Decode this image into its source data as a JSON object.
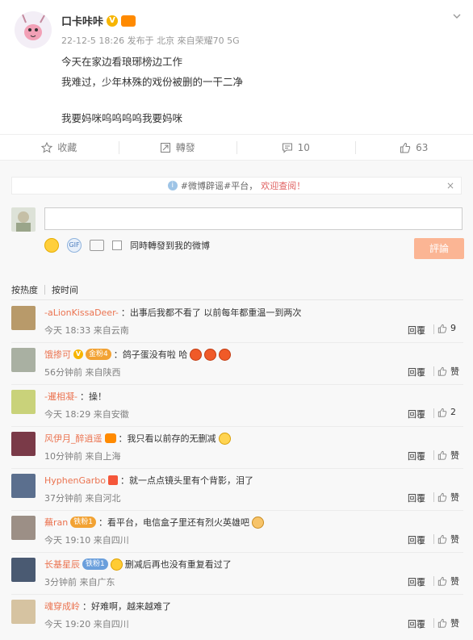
{
  "post": {
    "author": "口卡咔咔",
    "meta": "22-12-5 18:26 发布于 北京 來自荣耀70 5G",
    "lines": [
      "今天在家边看琅琊榜边工作",
      "我难过，少年林殊的戏份被删的一干二净",
      "我要妈咪呜呜呜呜我要妈咪"
    ]
  },
  "actions": {
    "favorite": "收藏",
    "repost": "轉發",
    "comment": "10",
    "like": "63"
  },
  "notice": {
    "text": "#微博辟谣#平台，",
    "warn": "欢迎查阅！",
    "close": "×"
  },
  "composer": {
    "sync_label": "同時轉發到我的微博",
    "submit_label": "評論",
    "gif_label": "GIF"
  },
  "sort": {
    "hot": "按热度",
    "time": "按时间"
  },
  "comments": [
    {
      "user": "-aLionKissaDeer-",
      "text": "：出事后我都不看了 以前每年都重温一到两次",
      "meta": "今天 18:33 来自云南",
      "reply": "回覆",
      "likes": "9"
    },
    {
      "user": "饿掺可",
      "badge": "金粉4",
      "text": "：鸽子蛋没有啦 哈",
      "meta": "56分钟前 来自陕西",
      "reply": "回覆",
      "likes": "赞"
    },
    {
      "user": "-暹相凝-",
      "text": "：操！",
      "meta": "今天 18:29 来自安徽",
      "reply": "回覆",
      "likes": "2"
    },
    {
      "user": "风伊月_醉逍遥",
      "text": "：我只看以前存的无删减",
      "meta": "10分钟前 来自上海",
      "reply": "回覆",
      "likes": "赞"
    },
    {
      "user": "HyphenGarbo",
      "text": "：就一点点镜头里有个背影，泪了",
      "meta": "37分钟前 来自河北",
      "reply": "回覆",
      "likes": "赞"
    },
    {
      "user": "蕪ran",
      "badge": "铁粉1",
      "text": "：看平台，电信盒子里还有烈火英雄吧",
      "meta": "今天 19:10 来自四川",
      "reply": "回覆",
      "likes": "赞"
    },
    {
      "user": "长基星辰",
      "badge": "铁粉1",
      "text": "删减后再也没有重复看过了",
      "meta": "3分钟前 来自广东",
      "reply": "回覆",
      "likes": "赞"
    },
    {
      "user": "魂穿成岭",
      "text": "：好难啊，越来越难了",
      "meta": "今天 19:20 来自四川",
      "reply": "回覆",
      "likes": "赞"
    }
  ]
}
